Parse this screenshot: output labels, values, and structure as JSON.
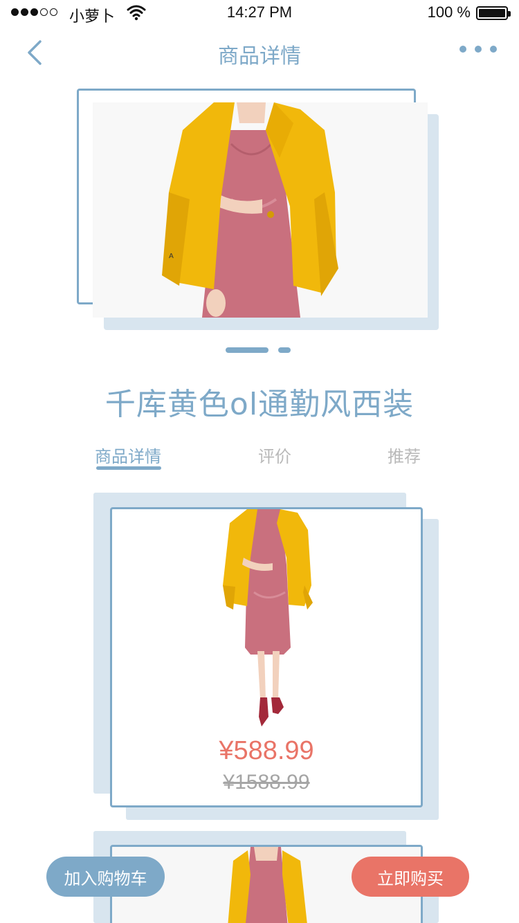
{
  "status_bar": {
    "carrier": "小萝卜",
    "time": "14:27 PM",
    "battery": "100 %"
  },
  "nav": {
    "title": "商品详情"
  },
  "gallery": {
    "pages": 2,
    "current_page": 1
  },
  "product": {
    "title": "千库黄色ol通勤风西装"
  },
  "tabs": [
    {
      "label": "商品详情",
      "active": true
    },
    {
      "label": "评价",
      "active": false
    },
    {
      "label": "推荐",
      "active": false
    }
  ],
  "cards": [
    {
      "price": "¥588.99",
      "old_price": "¥1588.99"
    }
  ],
  "actions": {
    "add_to_cart": "加入购物车",
    "buy_now": "立即购买"
  },
  "colors": {
    "accent_blue": "#7ea9c8",
    "light_blue": "#d8e5ef",
    "price_red": "#e97467",
    "jacket_yellow": "#f1b80b",
    "dress_pink": "#c9707e"
  }
}
